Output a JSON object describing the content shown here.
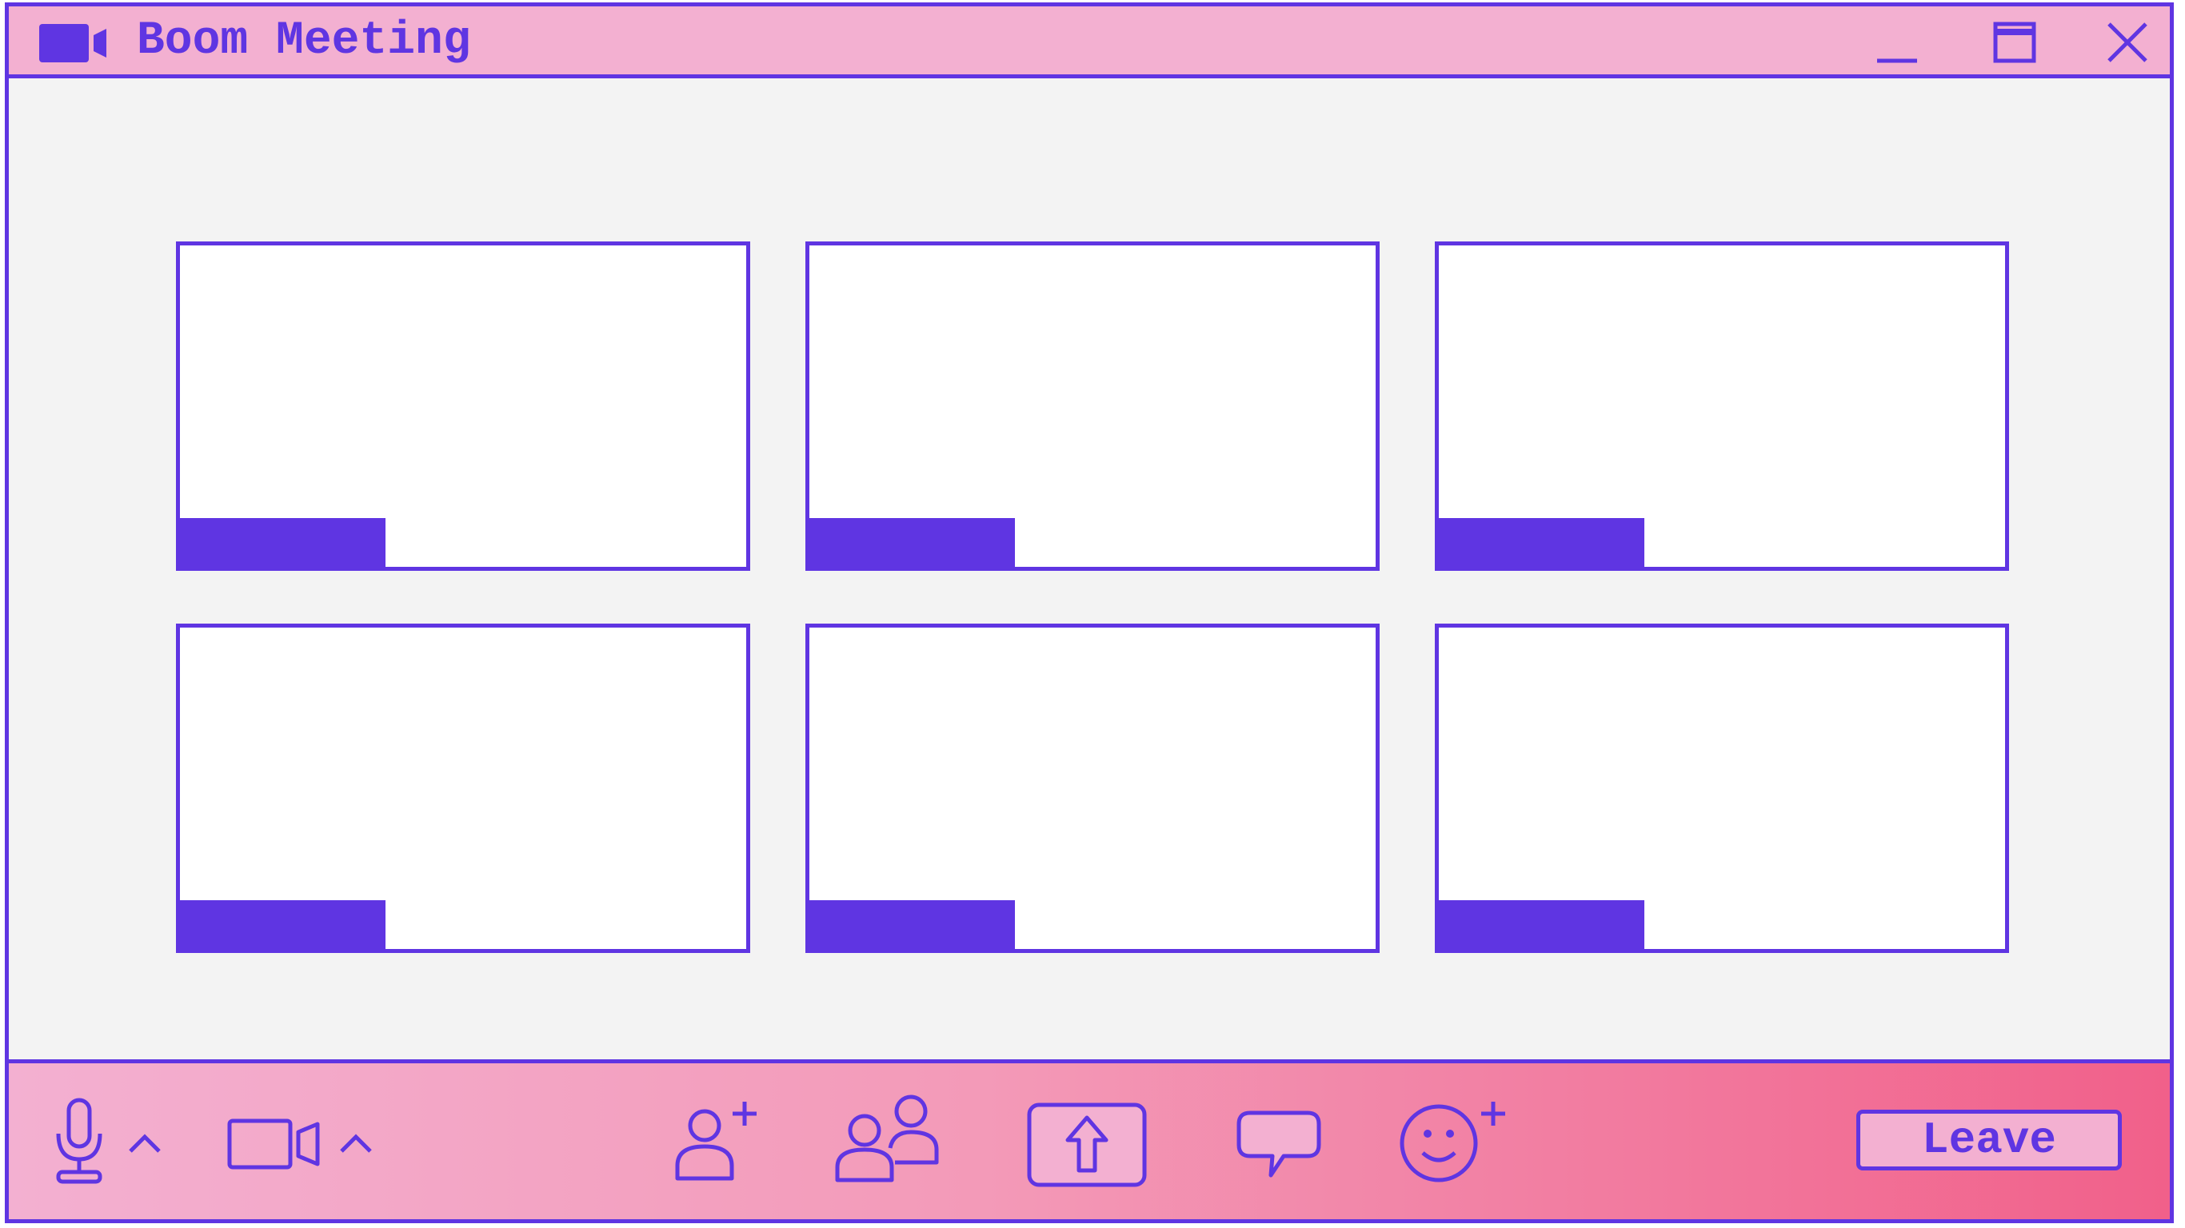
{
  "window": {
    "title": "Boom Meeting",
    "app_icon": "video-camera-icon",
    "controls": [
      "minimize-icon",
      "maximize-icon",
      "close-icon"
    ]
  },
  "participants": {
    "tile_count": 6,
    "rows": 2,
    "columns": 3
  },
  "toolbar": {
    "left": [
      "microphone-icon",
      "chevron-up-icon",
      "video-camera-icon",
      "chevron-up-icon"
    ],
    "center": [
      "add-participant-icon",
      "participants-icon",
      "share-screen-icon",
      "chat-icon",
      "add-reaction-icon"
    ],
    "leave_label": "Leave"
  },
  "colors": {
    "accent": "#5f35e2",
    "titlebar": "#f3b0d1",
    "toolbar_gradient_start": "#f3b0d1",
    "toolbar_gradient_end": "#f1608a",
    "background": "#f3f3f3",
    "tile": "#ffffff"
  }
}
